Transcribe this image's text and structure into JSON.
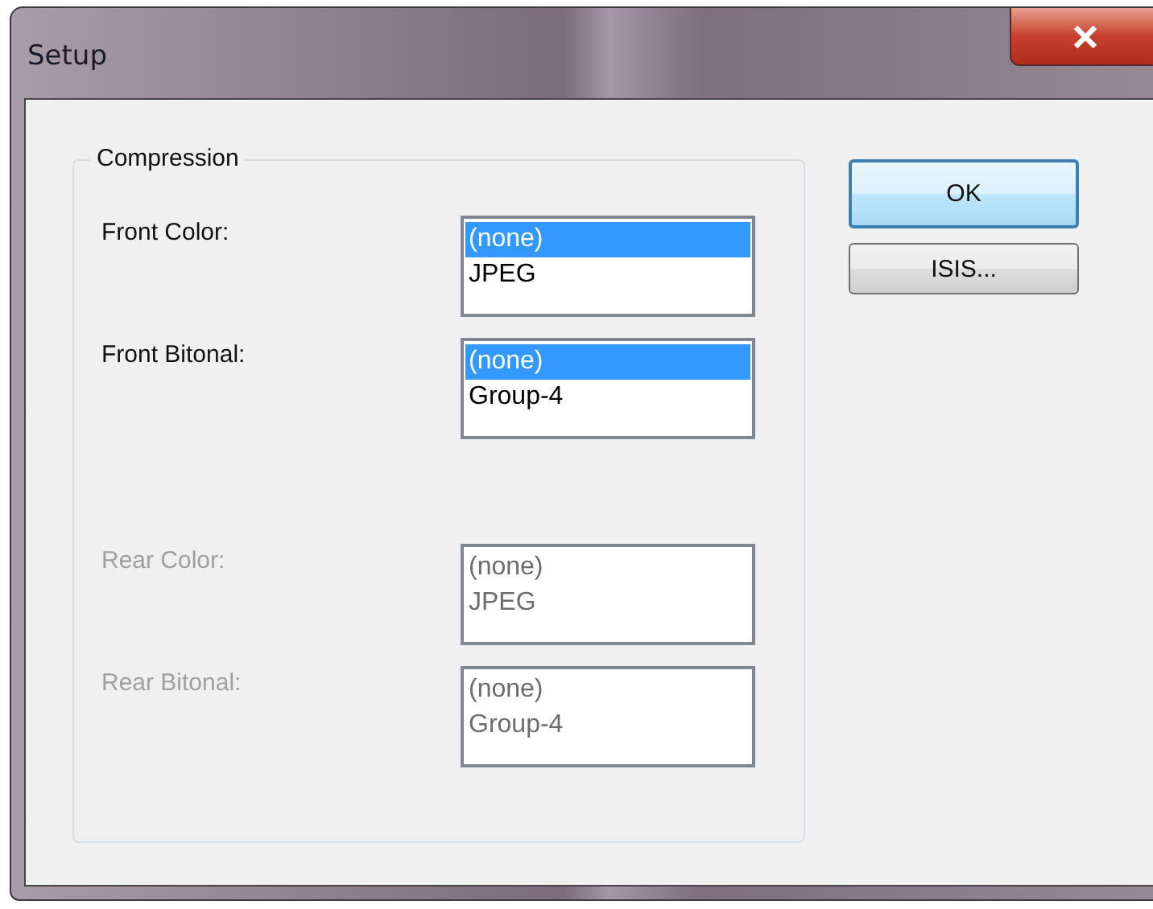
{
  "window": {
    "title": "Setup"
  },
  "group": {
    "label": "Compression",
    "rows": [
      {
        "label": "Front Color:",
        "disabled": false,
        "items": [
          {
            "text": "(none)",
            "selected": true
          },
          {
            "text": "JPEG",
            "selected": false
          }
        ]
      },
      {
        "label": "Front Bitonal:",
        "disabled": false,
        "items": [
          {
            "text": "(none)",
            "selected": true
          },
          {
            "text": "Group-4",
            "selected": false
          }
        ]
      },
      {
        "label": "Rear Color:",
        "disabled": true,
        "items": [
          {
            "text": "(none)",
            "selected": false
          },
          {
            "text": "JPEG",
            "selected": false
          }
        ]
      },
      {
        "label": "Rear Bitonal:",
        "disabled": true,
        "items": [
          {
            "text": "(none)",
            "selected": false
          },
          {
            "text": "Group-4",
            "selected": false
          }
        ]
      }
    ]
  },
  "buttons": [
    {
      "label": "OK",
      "default": true
    },
    {
      "label": "ISIS...",
      "default": false
    }
  ]
}
